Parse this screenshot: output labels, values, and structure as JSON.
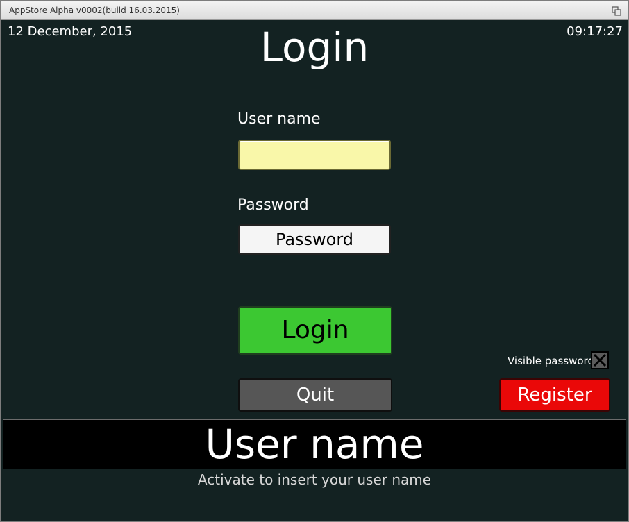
{
  "window": {
    "title": "AppStore Alpha v0002(build 16.03.2015)",
    "restore_icon": "restore-window-icon"
  },
  "status": {
    "date": "12 December, 2015",
    "time": "09:17:27"
  },
  "page": {
    "title": "Login"
  },
  "form": {
    "username_label": "User name",
    "username_value": "",
    "password_label": "Password",
    "password_value": "Password"
  },
  "buttons": {
    "login": "Login",
    "quit": "Quit",
    "register": "Register"
  },
  "options": {
    "visible_password_label": "Visible password",
    "visible_password_checked": true
  },
  "banner": {
    "title": "User name",
    "hint": "Activate to insert your user name"
  },
  "colors": {
    "background": "#132222",
    "username_field": "#f9f7a9",
    "login_button": "#3cc832",
    "quit_button": "#565656",
    "register_button": "#ea0808"
  }
}
